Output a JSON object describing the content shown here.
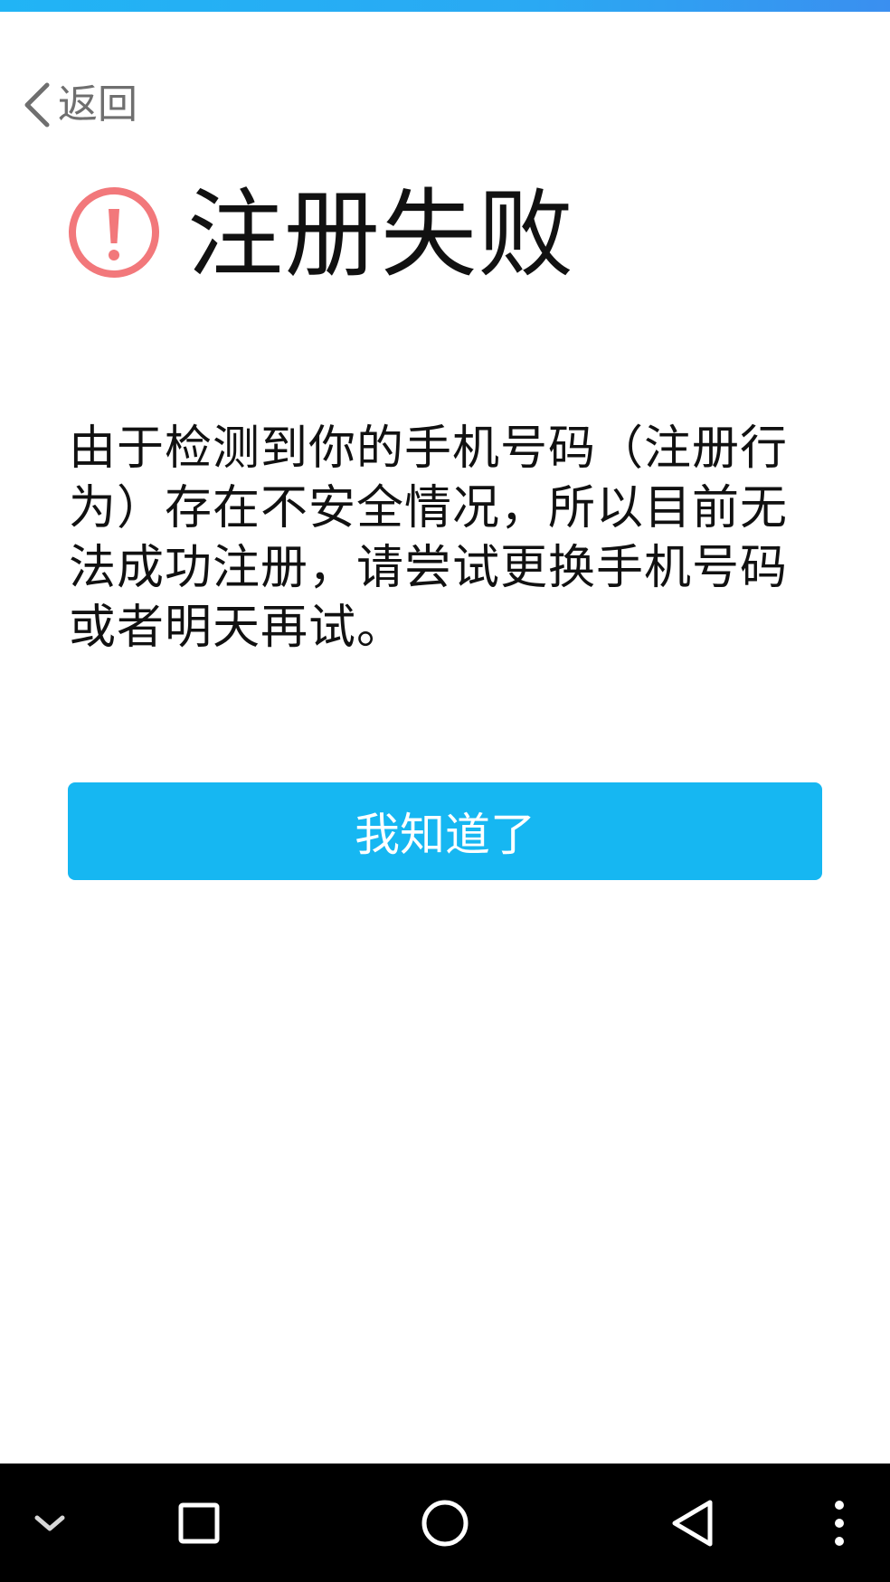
{
  "header": {
    "back_label": "返回"
  },
  "result": {
    "title": "注册失败",
    "message": "由于检测到你的手机号码（注册行为）存在不安全情况，所以目前无法成功注册，请尝试更换手机号码或者明天再试。",
    "status_color": "#f2787b"
  },
  "actions": {
    "confirm_label": "我知道了",
    "confirm_color": "#16b7f2"
  },
  "navigation_bar": {
    "icons": [
      "chevron-down-icon",
      "recents-square-icon",
      "home-circle-icon",
      "back-triangle-icon",
      "more-vert-icon"
    ]
  },
  "theme": {
    "accent": "#16b7f2",
    "top_bar": "#2aa9f3"
  }
}
